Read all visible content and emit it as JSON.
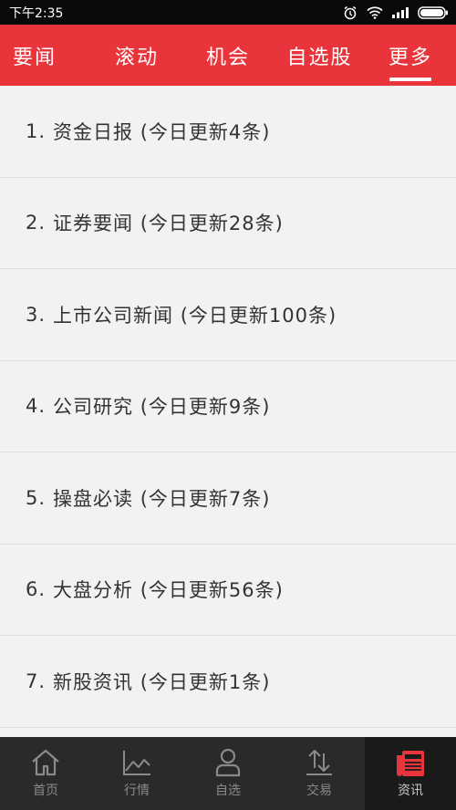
{
  "status_bar": {
    "time": "下午2:35",
    "icons": [
      "alarm-icon",
      "wifi-icon",
      "signal-icon",
      "battery-icon"
    ]
  },
  "top_tabs": [
    {
      "label": "要闻"
    },
    {
      "label": "滚动"
    },
    {
      "label": "机会"
    },
    {
      "label": "自选股"
    },
    {
      "label": "更多",
      "active": true
    }
  ],
  "list": {
    "items": [
      {
        "num": "1.",
        "text": "资金日报 (今日更新4条)"
      },
      {
        "num": "2.",
        "text": "证券要闻 (今日更新28条)"
      },
      {
        "num": "3.",
        "text": "上市公司新闻 (今日更新100条)"
      },
      {
        "num": "4.",
        "text": "公司研究 (今日更新9条)"
      },
      {
        "num": "5.",
        "text": "操盘必读 (今日更新7条)"
      },
      {
        "num": "6.",
        "text": "大盘分析 (今日更新56条)"
      },
      {
        "num": "7.",
        "text": "新股资讯 (今日更新1条)"
      }
    ]
  },
  "bottom_nav": [
    {
      "label": "首页",
      "icon": "home-icon"
    },
    {
      "label": "行情",
      "icon": "chart-icon"
    },
    {
      "label": "自选",
      "icon": "person-icon"
    },
    {
      "label": "交易",
      "icon": "transfer-icon"
    },
    {
      "label": "资讯",
      "icon": "news-icon",
      "active": true
    }
  ],
  "colors": {
    "brand_red": "#e8343a",
    "status_bar_bg": "#0a0a0a",
    "nav_bg": "#2a2a2a",
    "list_bg": "#f2f2f2"
  }
}
